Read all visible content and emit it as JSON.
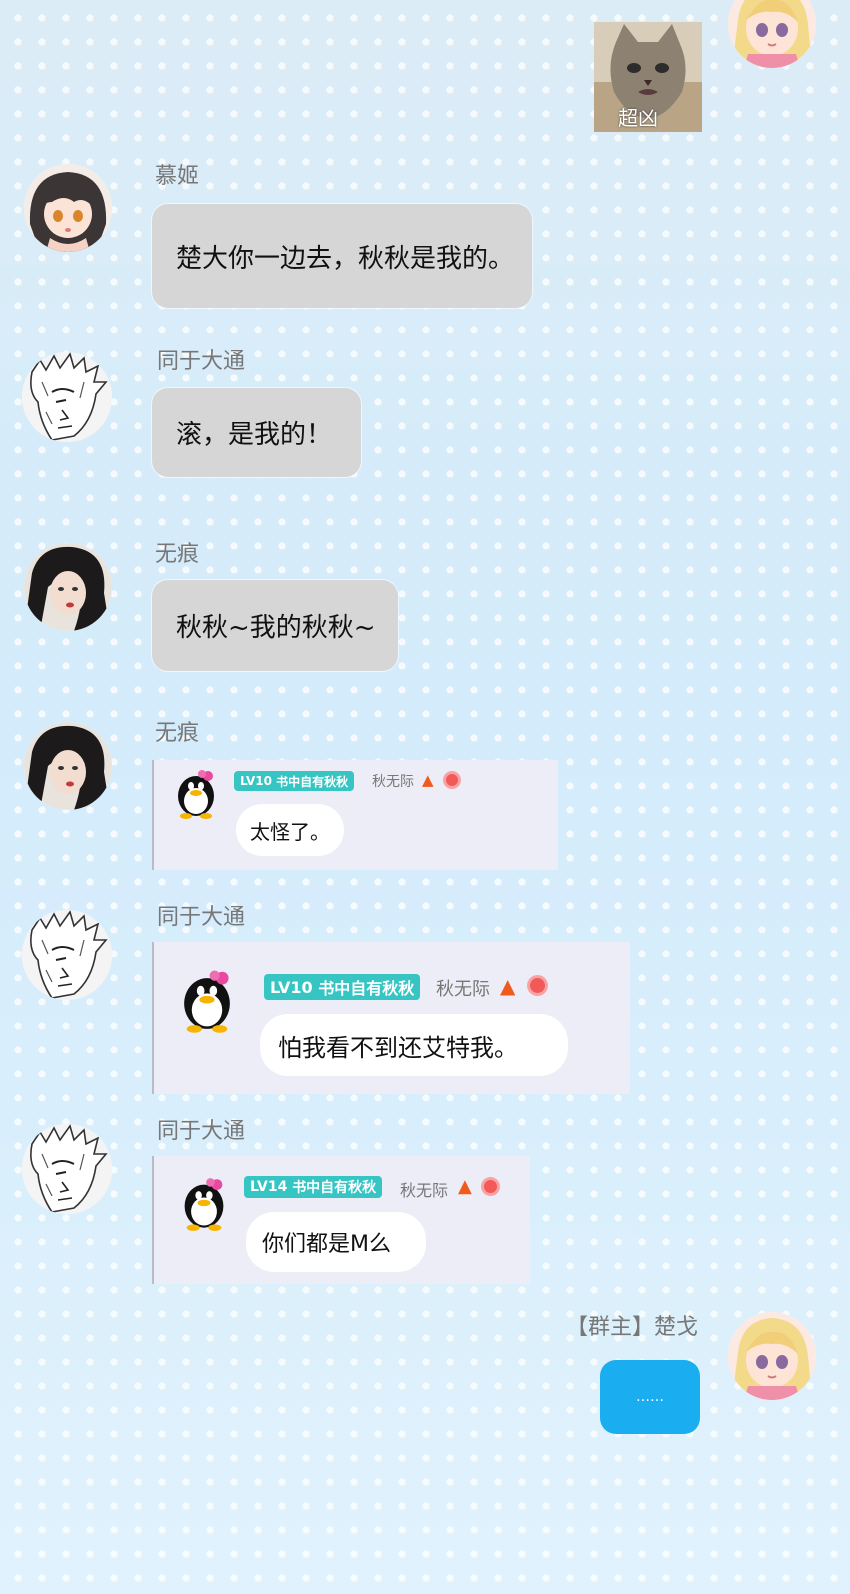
{
  "top_image": {
    "caption": "超凶"
  },
  "messages": [
    {
      "sender": "慕姬",
      "text": "楚大你一边去，秋秋是我的。"
    },
    {
      "sender": "同于大通",
      "text": "滚，是我的！"
    },
    {
      "sender": "无痕",
      "text": "秋秋~我的秋秋~"
    },
    {
      "sender": "无痕",
      "quote": {
        "level": "LV10",
        "title": "书中自有秋秋",
        "name": "秋无际",
        "text": "太怪了。"
      }
    },
    {
      "sender": "同于大通",
      "quote": {
        "level": "LV10",
        "title": "书中自有秋秋",
        "name": "秋无际",
        "text": "怕我看不到还艾特我。"
      }
    },
    {
      "sender": "同于大通",
      "quote": {
        "level": "LV14",
        "title": "书中自有秋秋",
        "name": "秋无际",
        "text": "你们都是M么"
      }
    }
  ],
  "self_message": {
    "sender": "【群主】楚戈",
    "text": "……"
  },
  "colors": {
    "self_bubble": "#1aaef0",
    "level_badge": "#36c5c2",
    "bubble_gray": "#d6d6d6",
    "quote_bg": "#ecedf7"
  }
}
